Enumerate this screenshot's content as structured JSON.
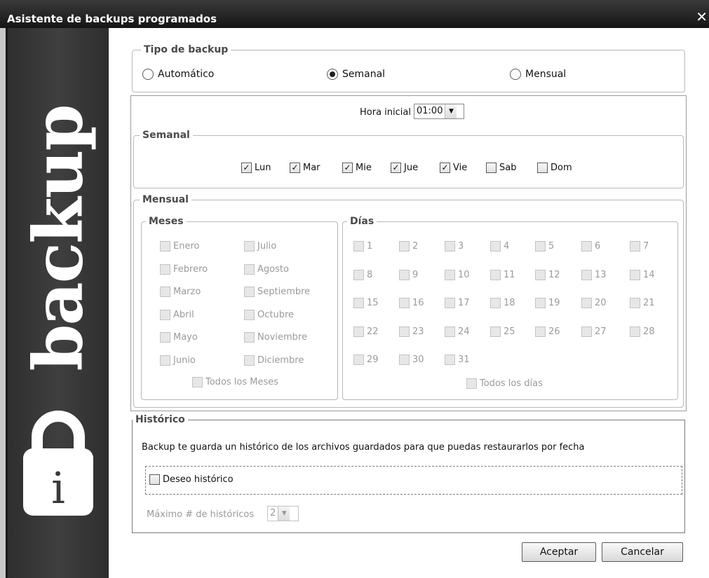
{
  "window": {
    "title": "Asistente de backups programados",
    "close_glyph": "✕"
  },
  "sidebar": {
    "brand": "backup",
    "lock_letter": "i"
  },
  "tipo": {
    "legend": "Tipo de backup",
    "options": [
      {
        "label": "Automático",
        "selected": false
      },
      {
        "label": "Semanal",
        "selected": true
      },
      {
        "label": "Mensual",
        "selected": false
      }
    ]
  },
  "hora": {
    "label": "Hora inicial",
    "value": "01:00"
  },
  "semanal": {
    "legend": "Semanal",
    "days": [
      {
        "label": "Lun",
        "checked": true
      },
      {
        "label": "Mar",
        "checked": true
      },
      {
        "label": "Mie",
        "checked": true
      },
      {
        "label": "Jue",
        "checked": true
      },
      {
        "label": "Vie",
        "checked": true
      },
      {
        "label": "Sab",
        "checked": false
      },
      {
        "label": "Dom",
        "checked": false
      }
    ]
  },
  "mensual": {
    "legend": "Mensual",
    "meses_legend": "Meses",
    "meses": [
      "Enero",
      "Febrero",
      "Marzo",
      "Abril",
      "Mayo",
      "Junio",
      "Julio",
      "Agosto",
      "Septiembre",
      "Octubre",
      "Noviembre",
      "Diciembre"
    ],
    "todos_meses": "Todos los Meses",
    "dias_legend": "Días",
    "dias": [
      "1",
      "2",
      "3",
      "4",
      "5",
      "6",
      "7",
      "8",
      "9",
      "10",
      "11",
      "12",
      "13",
      "14",
      "15",
      "16",
      "17",
      "18",
      "19",
      "20",
      "21",
      "22",
      "23",
      "24",
      "25",
      "26",
      "27",
      "28",
      "29",
      "30",
      "31"
    ],
    "todos_dias": "Todos los días"
  },
  "historico": {
    "legend": "Histórico",
    "description": "Backup te guarda un histórico de los archivos guardados para que puedas restaurarlos por fecha",
    "deseo_label": "Deseo histórico",
    "deseo_checked": false,
    "maximo_label": "Máximo # de históricos",
    "maximo_value": "2"
  },
  "buttons": {
    "aceptar": "Aceptar",
    "cancelar": "Cancelar"
  },
  "icons": {
    "check": "✓",
    "dropdown": "▼"
  }
}
